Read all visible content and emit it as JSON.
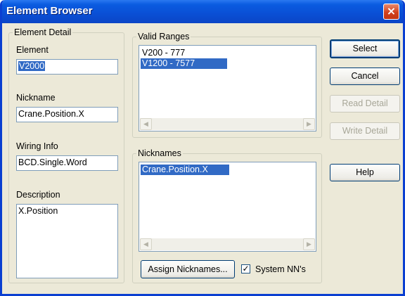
{
  "window": {
    "title": "Element Browser",
    "close_icon": "×"
  },
  "element_detail": {
    "group_title": "Element Detail",
    "element_label": "Element",
    "element_value": "V2000",
    "nickname_label": "Nickname",
    "nickname_value": "Crane.Position.X",
    "wiring_label": "Wiring Info",
    "wiring_value": "BCD.Single.Word",
    "description_label": "Description",
    "description_value": "X.Position"
  },
  "valid_ranges": {
    "group_title": "Valid Ranges",
    "items": [
      "V200 - 777",
      "V1200 - 7577"
    ],
    "selected_index": 1
  },
  "nicknames": {
    "group_title": "Nicknames",
    "items": [
      "Crane.Position.X"
    ],
    "selected_index": 0,
    "assign_button": "Assign Nicknames...",
    "system_nn_label": "System NN's",
    "system_nn_checked": true,
    "check_mark": "✓"
  },
  "buttons": {
    "select": "Select",
    "cancel": "Cancel",
    "read_detail": "Read Detail",
    "write_detail": "Write Detail",
    "help": "Help"
  },
  "scroll_arrows": {
    "left": "◀",
    "right": "▶"
  },
  "colors": {
    "title_bar": "#0a4fd5",
    "selection": "#316ac5",
    "dialog_bg": "#ece9d8"
  }
}
